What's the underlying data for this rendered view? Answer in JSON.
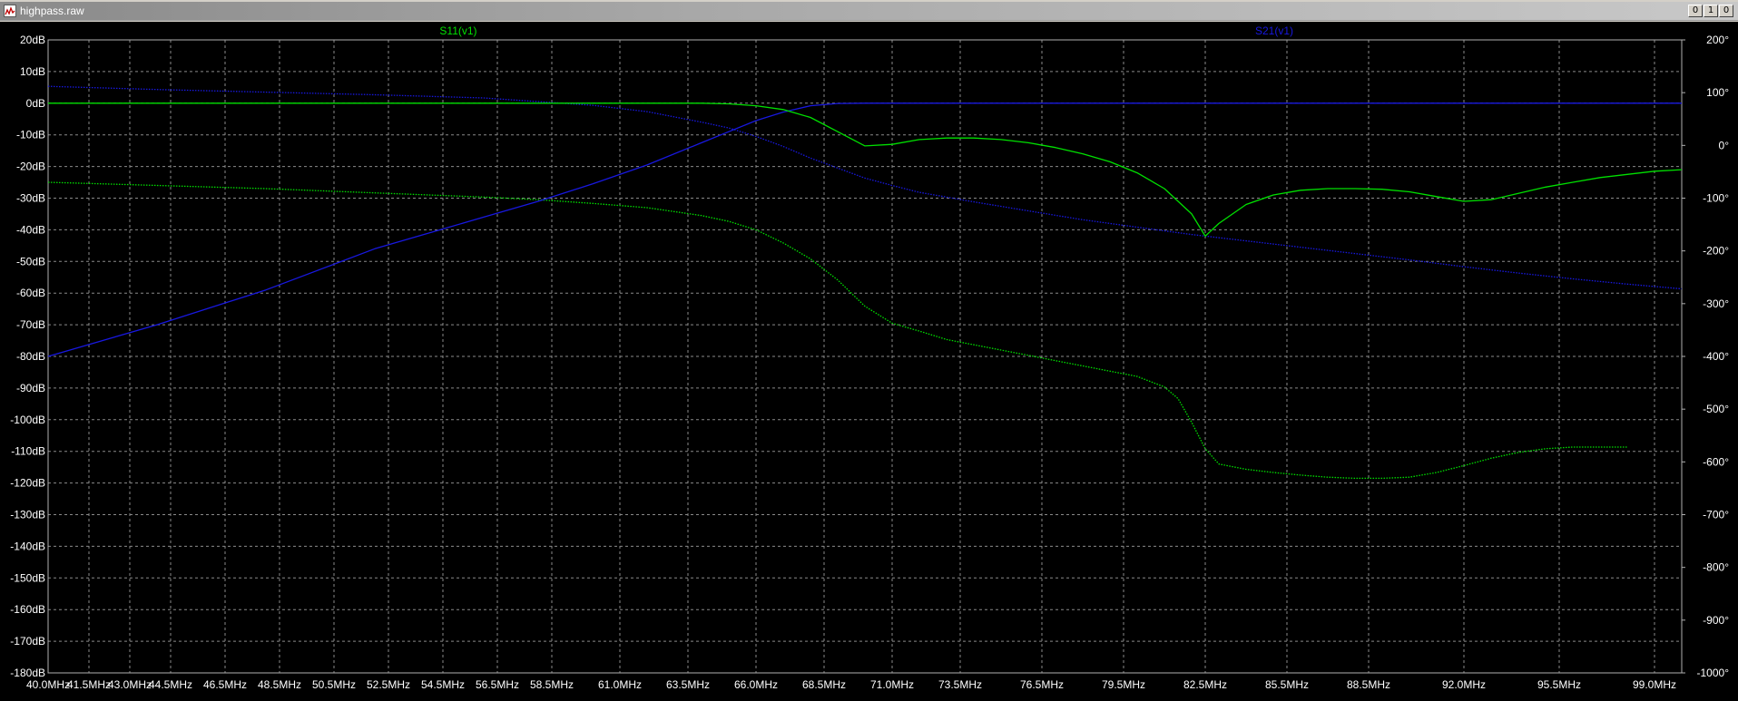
{
  "window": {
    "title": "highpass.raw",
    "buttons": {
      "minimize": "0",
      "restore": "1",
      "close": "0"
    }
  },
  "colors": {
    "s11": "#00e000",
    "s21": "#1818e0",
    "grid": "#8a8a8a",
    "frame": "#b0b0b0",
    "text": "#ffffff",
    "background": "#000000"
  },
  "chart_data": {
    "type": "line",
    "title": "",
    "grid": true,
    "xlim": [
      40.0,
      100.0
    ],
    "x_ticks": [
      "40.0MHz",
      "41.5MHz",
      "43.0MHz",
      "44.5MHz",
      "46.5MHz",
      "48.5MHz",
      "50.5MHz",
      "52.5MHz",
      "54.5MHz",
      "56.5MHz",
      "58.5MHz",
      "61.0MHz",
      "63.5MHz",
      "66.0MHz",
      "68.5MHz",
      "71.0MHz",
      "73.5MHz",
      "76.5MHz",
      "79.5MHz",
      "82.5MHz",
      "85.5MHz",
      "88.5MHz",
      "92.0MHz",
      "95.5MHz",
      "99.0MHz"
    ],
    "x_tick_values": [
      40.0,
      41.5,
      43.0,
      44.5,
      46.5,
      48.5,
      50.5,
      52.5,
      54.5,
      56.5,
      58.5,
      61.0,
      63.5,
      66.0,
      68.5,
      71.0,
      73.5,
      76.5,
      79.5,
      82.5,
      85.5,
      88.5,
      92.0,
      95.5,
      99.0
    ],
    "y_left": {
      "unit": "dB",
      "ylim": [
        -180,
        20
      ],
      "ticks": [
        "20dB",
        "10dB",
        "0dB",
        "-10dB",
        "-20dB",
        "-30dB",
        "-40dB",
        "-50dB",
        "-60dB",
        "-70dB",
        "-80dB",
        "-90dB",
        "-100dB",
        "-110dB",
        "-120dB",
        "-130dB",
        "-140dB",
        "-150dB",
        "-160dB",
        "-170dB",
        "-180dB"
      ],
      "tick_values": [
        20,
        10,
        0,
        -10,
        -20,
        -30,
        -40,
        -50,
        -60,
        -70,
        -80,
        -90,
        -100,
        -110,
        -120,
        -130,
        -140,
        -150,
        -160,
        -170,
        -180
      ]
    },
    "y_right": {
      "unit": "degrees",
      "ylim": [
        -1000,
        200
      ],
      "ticks": [
        "200°",
        "100°",
        "0°",
        "-100°",
        "-200°",
        "-300°",
        "-400°",
        "-500°",
        "-600°",
        "-700°",
        "-800°",
        "-900°",
        "-1000°"
      ],
      "tick_values": [
        200,
        100,
        0,
        -100,
        -200,
        -300,
        -400,
        -500,
        -600,
        -700,
        -800,
        -900,
        -1000
      ]
    },
    "series": [
      {
        "name": "S11(v1)",
        "color": "#00e000",
        "magnitude_db": {
          "x": [
            40,
            44,
            48,
            52,
            56,
            60,
            62,
            64,
            65,
            66,
            67,
            68,
            69,
            70,
            71,
            72,
            73,
            74,
            75,
            76,
            77,
            78,
            79,
            80,
            81,
            82,
            82.5,
            83,
            84,
            85,
            86,
            87,
            88,
            89,
            90,
            91,
            92,
            93,
            94,
            95,
            96,
            97,
            98,
            99,
            100
          ],
          "y": [
            0,
            0,
            0,
            0,
            0,
            0,
            0,
            0,
            -0.2,
            -0.8,
            -2,
            -4.5,
            -9,
            -13.5,
            -13,
            -11.5,
            -11,
            -11,
            -11.5,
            -12.5,
            -14,
            -16,
            -18.5,
            -22,
            -27,
            -35,
            -42,
            -38,
            -32,
            -29,
            -27.5,
            -27,
            -27,
            -27.2,
            -28,
            -29.5,
            -31,
            -30.5,
            -28.5,
            -26.5,
            -25,
            -23.5,
            -22.5,
            -21.5,
            -21
          ]
        },
        "phase_deg": {
          "x": [
            40,
            44,
            48,
            52,
            56,
            58,
            60,
            62,
            64,
            65,
            66,
            67,
            68,
            69,
            70,
            71,
            72,
            73,
            74,
            75,
            76,
            77,
            78,
            79,
            80,
            81,
            81.5,
            82,
            82.5,
            83,
            84,
            85,
            86,
            87,
            88,
            89,
            90,
            91,
            92,
            93,
            94,
            95,
            96,
            97,
            98,
            99,
            100
          ],
          "y": [
            -70,
            -76,
            -82,
            -90,
            -98,
            -103,
            -110,
            -118,
            -133,
            -144,
            -160,
            -185,
            -215,
            -255,
            -305,
            -337,
            -352,
            -368,
            -378,
            -388,
            -398,
            -408,
            -418,
            -428,
            -438,
            -458,
            -480,
            -525,
            -575,
            -604,
            -614,
            -620,
            -625,
            -629,
            -631,
            -631,
            -629,
            -620,
            -607,
            -593,
            -582,
            -575,
            -572,
            -572,
            -572
          ]
        }
      },
      {
        "name": "S21(v1)",
        "color": "#1818e0",
        "magnitude_db": {
          "x": [
            40,
            44,
            48,
            52,
            56,
            58,
            60,
            62,
            64,
            65,
            66,
            67,
            68,
            69,
            70,
            72,
            74,
            76,
            78,
            80,
            85,
            90,
            95,
            100
          ],
          "y": [
            -80,
            -70,
            -59,
            -46,
            -36,
            -31,
            -25.5,
            -19.5,
            -12.5,
            -9,
            -5.5,
            -2.8,
            -0.8,
            -0.1,
            0,
            0,
            0,
            0,
            0,
            0,
            0,
            0,
            0,
            0
          ]
        },
        "phase_deg": {
          "x": [
            40,
            44,
            48,
            52,
            56,
            60,
            62,
            64,
            65,
            66,
            67,
            68,
            69,
            70,
            71,
            72,
            74,
            76,
            78,
            80,
            82,
            84,
            86,
            88,
            90,
            92,
            94,
            96,
            98,
            100
          ],
          "y": [
            112,
            106,
            101,
            96,
            90,
            76,
            64,
            44,
            33,
            17,
            -2,
            -24,
            -43,
            -62,
            -76,
            -89,
            -107,
            -124,
            -141,
            -155,
            -169,
            -181,
            -193,
            -205,
            -217,
            -230,
            -242,
            -253,
            -263,
            -272
          ]
        }
      }
    ]
  }
}
